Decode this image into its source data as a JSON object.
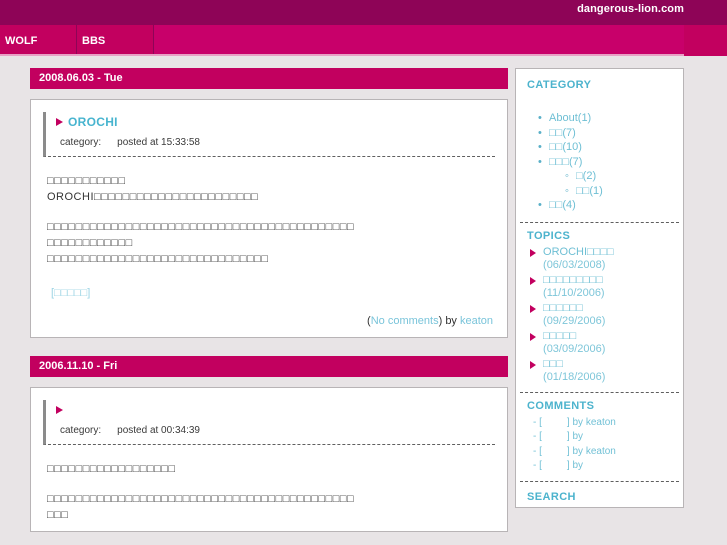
{
  "header": {
    "site_title": "dangerous-lion.com",
    "accent_dark": "#8e0457",
    "accent_bright": "#c2005f",
    "link_cyan": "#47b4cf",
    "page_bg": "#e8e4e6"
  },
  "nav": {
    "tabs": [
      {
        "label": "WOLF"
      },
      {
        "label": "BBS"
      }
    ]
  },
  "posts": [
    {
      "date_bar": "2008.06.03 - Tue",
      "title": "OROCHI",
      "category_label": "category:",
      "category_value": "",
      "posted_label": "posted at 15:33:58",
      "body_lines": [
        "□□□□□□□□□□□",
        "OROCHI□□□□□□□□□□□□□□□□□□□□□□□",
        "",
        "□□□□□□□□□□□□□□□□□□□□□□□□□□□□□□□□□□□□□□□□□□□",
        "□□□□□□□□□□□□",
        "□□□□□□□□□□□□□□□□□□□□□□□□□□□□□□□"
      ],
      "more_link": "[□□□□□]",
      "footer_open": "(",
      "footer_comments": "No comments",
      "footer_close": ")",
      "footer_by": "by",
      "footer_author": "keaton"
    },
    {
      "date_bar": "2006.11.10 - Fri",
      "title": "",
      "category_label": "category:",
      "category_value": "",
      "posted_label": "posted at 00:34:39",
      "body_lines": [
        "□□□□□□□□□□□□□□□□□□",
        "",
        "□□□□□□□□□□□□□□□□□□□□□□□□□□□□□□□□□□□□□□□□□□□",
        "□□□"
      ]
    }
  ],
  "sidebar": {
    "category": {
      "heading": "CATEGORY",
      "items": [
        {
          "label": "About(1)"
        },
        {
          "label": "□□(7)"
        },
        {
          "label": "□□(10)"
        },
        {
          "label": "□□□(7)",
          "children": [
            {
              "label": "□(2)"
            },
            {
              "label": "□□(1)"
            }
          ]
        },
        {
          "label": "□□(4)"
        }
      ]
    },
    "topics": {
      "heading": "TOPICS",
      "items": [
        {
          "title": "OROCHI□□□□",
          "date": "(06/03/2008)"
        },
        {
          "title": "□□□□□□□□□",
          "date": "(11/10/2006)"
        },
        {
          "title": "□□□□□□",
          "date": "(09/29/2006)"
        },
        {
          "title": "□□□□□",
          "date": "(03/09/2006)"
        },
        {
          "title": "□□□",
          "date": "(01/18/2006)"
        }
      ]
    },
    "comments": {
      "heading": "COMMENTS",
      "items": [
        {
          "text": "- [         ] by keaton"
        },
        {
          "text": "- [         ] by"
        },
        {
          "text": "- [         ] by keaton"
        },
        {
          "text": "- [         ] by"
        }
      ]
    },
    "search": {
      "heading": "SEARCH"
    }
  }
}
